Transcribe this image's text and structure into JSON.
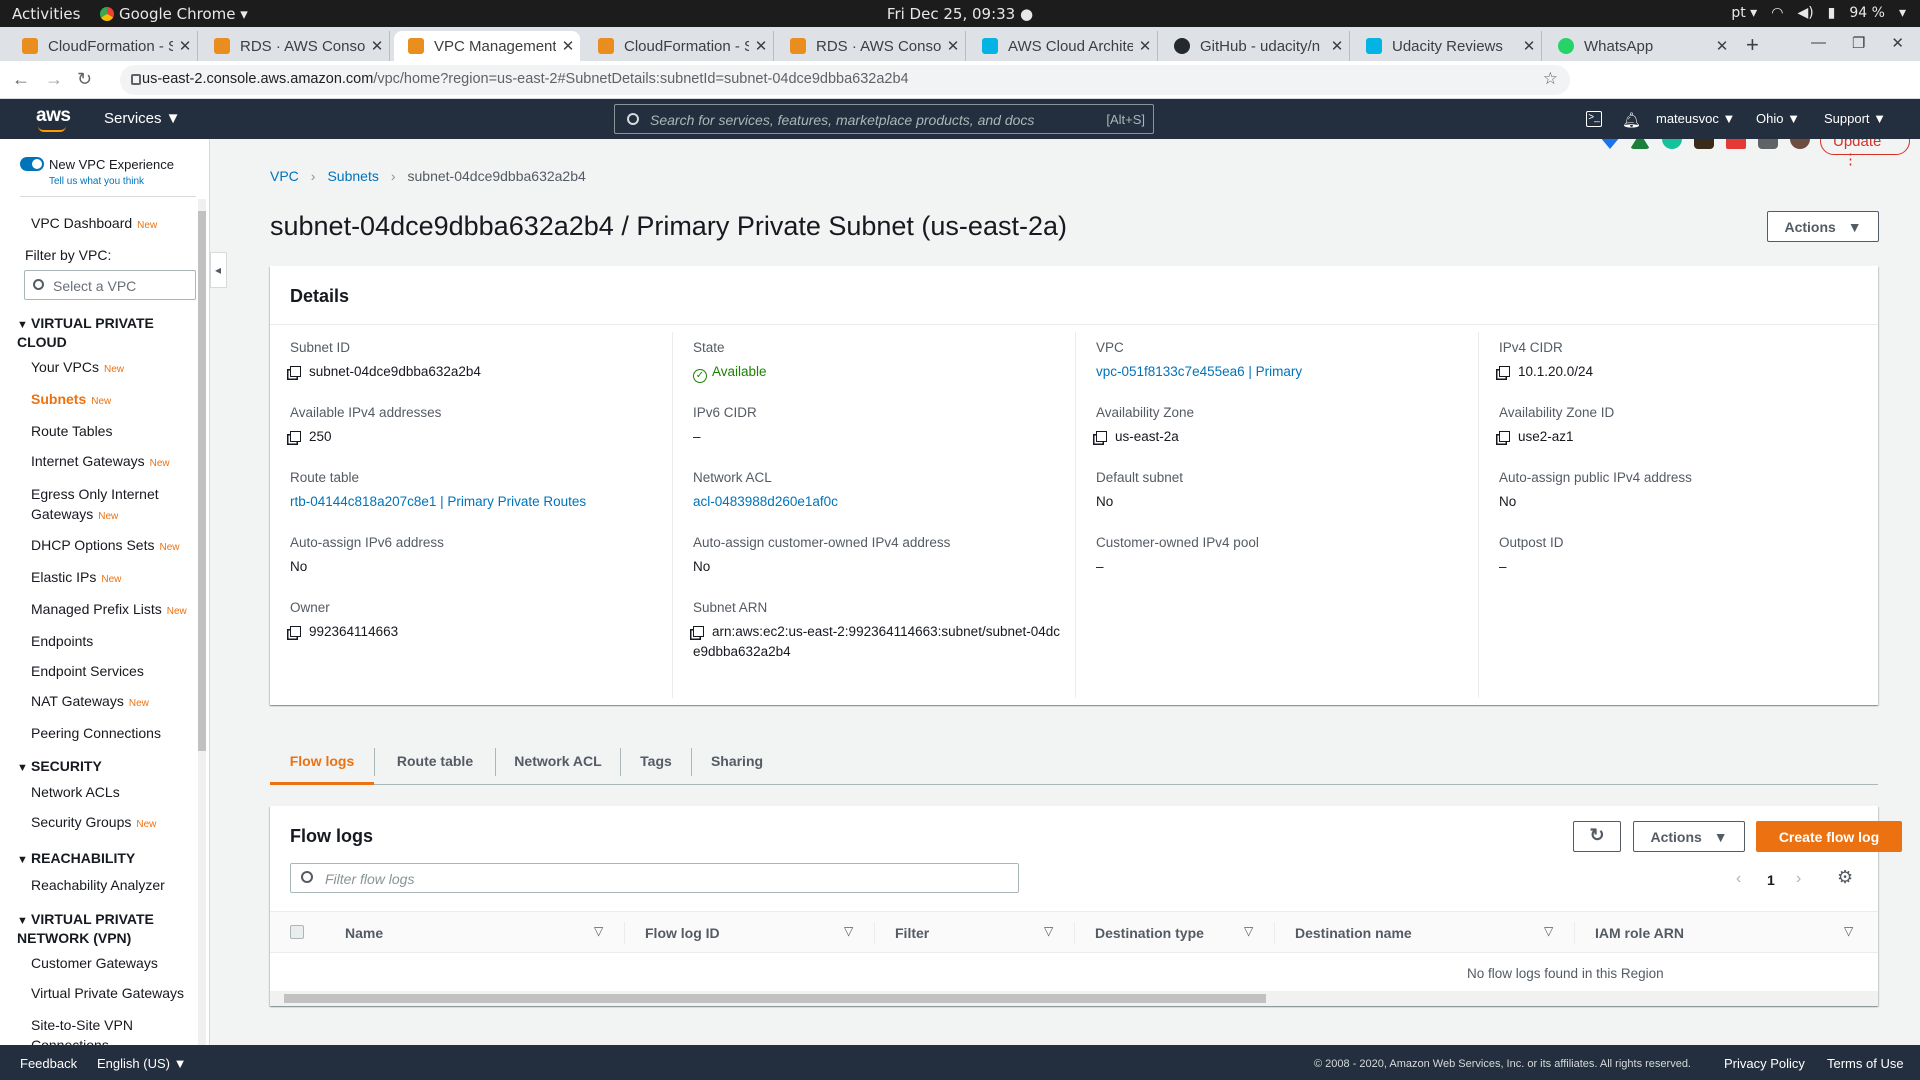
{
  "os": {
    "activities": "Activities",
    "app": "Google Chrome ▾",
    "clock": "Fri Dec 25, 09:33 ●",
    "lang": "pt ▾",
    "battery": "94 %"
  },
  "tabs": [
    {
      "title": "CloudFormation - S",
      "color": "#e98e1e"
    },
    {
      "title": "RDS · AWS Console",
      "color": "#e98e1e"
    },
    {
      "title": "VPC Management (",
      "color": "#e98e1e"
    },
    {
      "title": "CloudFormation - S",
      "color": "#e98e1e"
    },
    {
      "title": "RDS · AWS Console",
      "color": "#e98e1e"
    },
    {
      "title": "AWS Cloud Archite",
      "color": "#02b3e4"
    },
    {
      "title": "GitHub - udacity/n",
      "color": "#24292e"
    },
    {
      "title": "Udacity Reviews",
      "color": "#02b3e4"
    },
    {
      "title": "WhatsApp",
      "color": "#25d366"
    }
  ],
  "url": {
    "host": "us-east-2.console.aws.amazon.com",
    "path": "/vpc/home?region=us-east-2#SubnetDetails:subnetId=subnet-04dce9dbba632a2b4"
  },
  "browser": {
    "update": "Update",
    "menu": "⋮"
  },
  "aws": {
    "logo": "aws",
    "services": "Services ▼",
    "search_placeholder": "Search for services, features, marketplace products, and docs",
    "search_shortcut": "[Alt+S]",
    "user": "mateusvoc ▼",
    "region": "Ohio ▼",
    "support": "Support ▼"
  },
  "sidebar": {
    "new_experience": "New VPC Experience",
    "tell_us": "Tell us what you think",
    "dashboard": "VPC Dashboard",
    "filter_label": "Filter by VPC:",
    "vpc_placeholder": "Select a VPC",
    "new_badge": "New",
    "sec_vpc": "VIRTUAL PRIVATE CLOUD",
    "sec_security": "SECURITY",
    "sec_reach": "REACHABILITY",
    "sec_vpn": "VIRTUAL PRIVATE NETWORK (VPN)",
    "items": [
      "Your VPCs",
      "Subnets",
      "Route Tables",
      "Internet Gateways",
      "Egress Only Internet Gateways",
      "DHCP Options Sets",
      "Elastic IPs",
      "Managed Prefix Lists",
      "Endpoints",
      "Endpoint Services",
      "NAT Gateways",
      "Peering Connections",
      "Network ACLs",
      "Security Groups",
      "Reachability Analyzer",
      "Customer Gateways",
      "Virtual Private Gateways",
      "Site-to-Site VPN Connections"
    ]
  },
  "breadcrumb": [
    "VPC",
    "Subnets",
    "subnet-04dce9dbba632a2b4"
  ],
  "page_title": "subnet-04dce9dbba632a2b4 / Primary Private Subnet (us-east-2a)",
  "actions_label": "Actions",
  "details": {
    "heading": "Details",
    "subnet_id": {
      "k": "Subnet ID",
      "v": "subnet-04dce9dbba632a2b4"
    },
    "available_ipv4": {
      "k": "Available IPv4 addresses",
      "v": "250"
    },
    "route_table": {
      "k": "Route table",
      "v": "rtb-04144c818a207c8e1 | Primary Private Routes"
    },
    "auto_ipv6": {
      "k": "Auto-assign IPv6 address",
      "v": "No"
    },
    "owner": {
      "k": "Owner",
      "v": "992364114663"
    },
    "state": {
      "k": "State",
      "v": "Available"
    },
    "ipv6_cidr": {
      "k": "IPv6 CIDR",
      "v": "–"
    },
    "network_acl": {
      "k": "Network ACL",
      "v": "acl-0483988d260e1af0c"
    },
    "auto_customer": {
      "k": "Auto-assign customer-owned IPv4 address",
      "v": "No"
    },
    "subnet_arn": {
      "k": "Subnet ARN",
      "v": "arn:aws:ec2:us-east-2:992364114663:subnet/subnet-04dce9dbba632a2b4"
    },
    "vpc": {
      "k": "VPC",
      "v": "vpc-051f8133c7e455ea6 | Primary"
    },
    "az": {
      "k": "Availability Zone",
      "v": "us-east-2a"
    },
    "default_subnet": {
      "k": "Default subnet",
      "v": "No"
    },
    "customer_pool": {
      "k": "Customer-owned IPv4 pool",
      "v": "–"
    },
    "ipv4_cidr": {
      "k": "IPv4 CIDR",
      "v": "10.1.20.0/24"
    },
    "az_id": {
      "k": "Availability Zone ID",
      "v": "use2-az1"
    },
    "auto_public": {
      "k": "Auto-assign public IPv4 address",
      "v": "No"
    },
    "outpost": {
      "k": "Outpost ID",
      "v": "–"
    }
  },
  "tabs_detail": [
    "Flow logs",
    "Route table",
    "Network ACL",
    "Tags",
    "Sharing"
  ],
  "flowlogs": {
    "heading": "Flow logs",
    "actions": "Actions",
    "create": "Create flow log",
    "filter_placeholder": "Filter flow logs",
    "page": "1",
    "columns": [
      "Name",
      "Flow log ID",
      "Filter",
      "Destination type",
      "Destination name",
      "IAM role ARN"
    ],
    "empty": "No flow logs found in this Region"
  },
  "footer": {
    "feedback": "Feedback",
    "language": "English (US) ▼",
    "copyright": "© 2008 - 2020, Amazon Web Services, Inc. or its affiliates. All rights reserved.",
    "privacy": "Privacy Policy",
    "terms": "Terms of Use"
  }
}
